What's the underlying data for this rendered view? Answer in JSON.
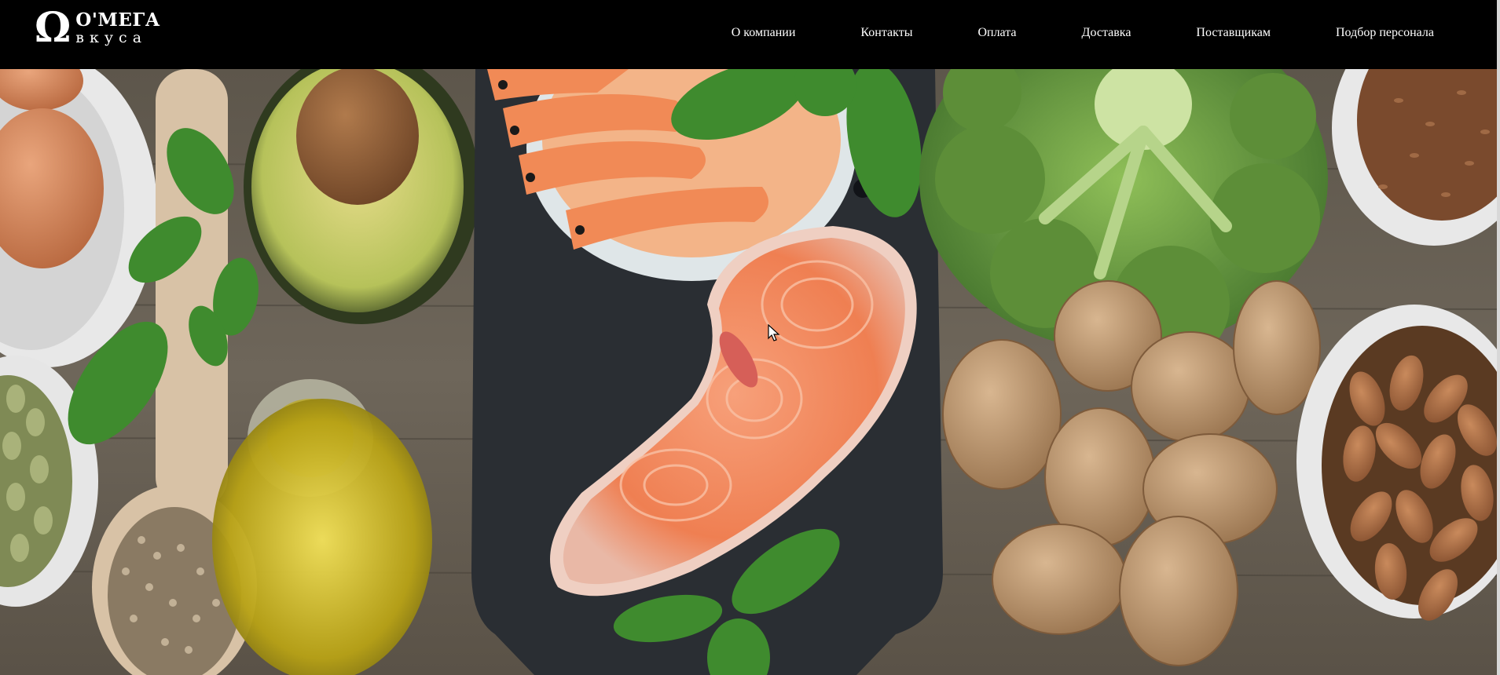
{
  "header": {
    "logo": {
      "symbol": "Ω",
      "title": "О'МЕГА",
      "subtitle": "вкуса"
    },
    "nav": [
      {
        "label": "О компании"
      },
      {
        "label": "Контакты"
      },
      {
        "label": "Оплата"
      },
      {
        "label": "Доставка"
      },
      {
        "label": "Поставщикам"
      },
      {
        "label": "Подбор персонала"
      }
    ]
  },
  "hero": {
    "items": [
      "eggs",
      "basil",
      "avocado",
      "shrimp",
      "salmon-steak",
      "broccoli",
      "flax-seeds",
      "walnuts",
      "almonds",
      "olive-oil",
      "hemp-seeds",
      "pumpkin-seeds",
      "wooden-spoon",
      "cutting-board"
    ]
  },
  "colors": {
    "header_bg": "#000000",
    "nav_text": "#ffffff",
    "wood": "#6b6254",
    "board": "#2a2e33",
    "salmon": "#f08a5d"
  }
}
